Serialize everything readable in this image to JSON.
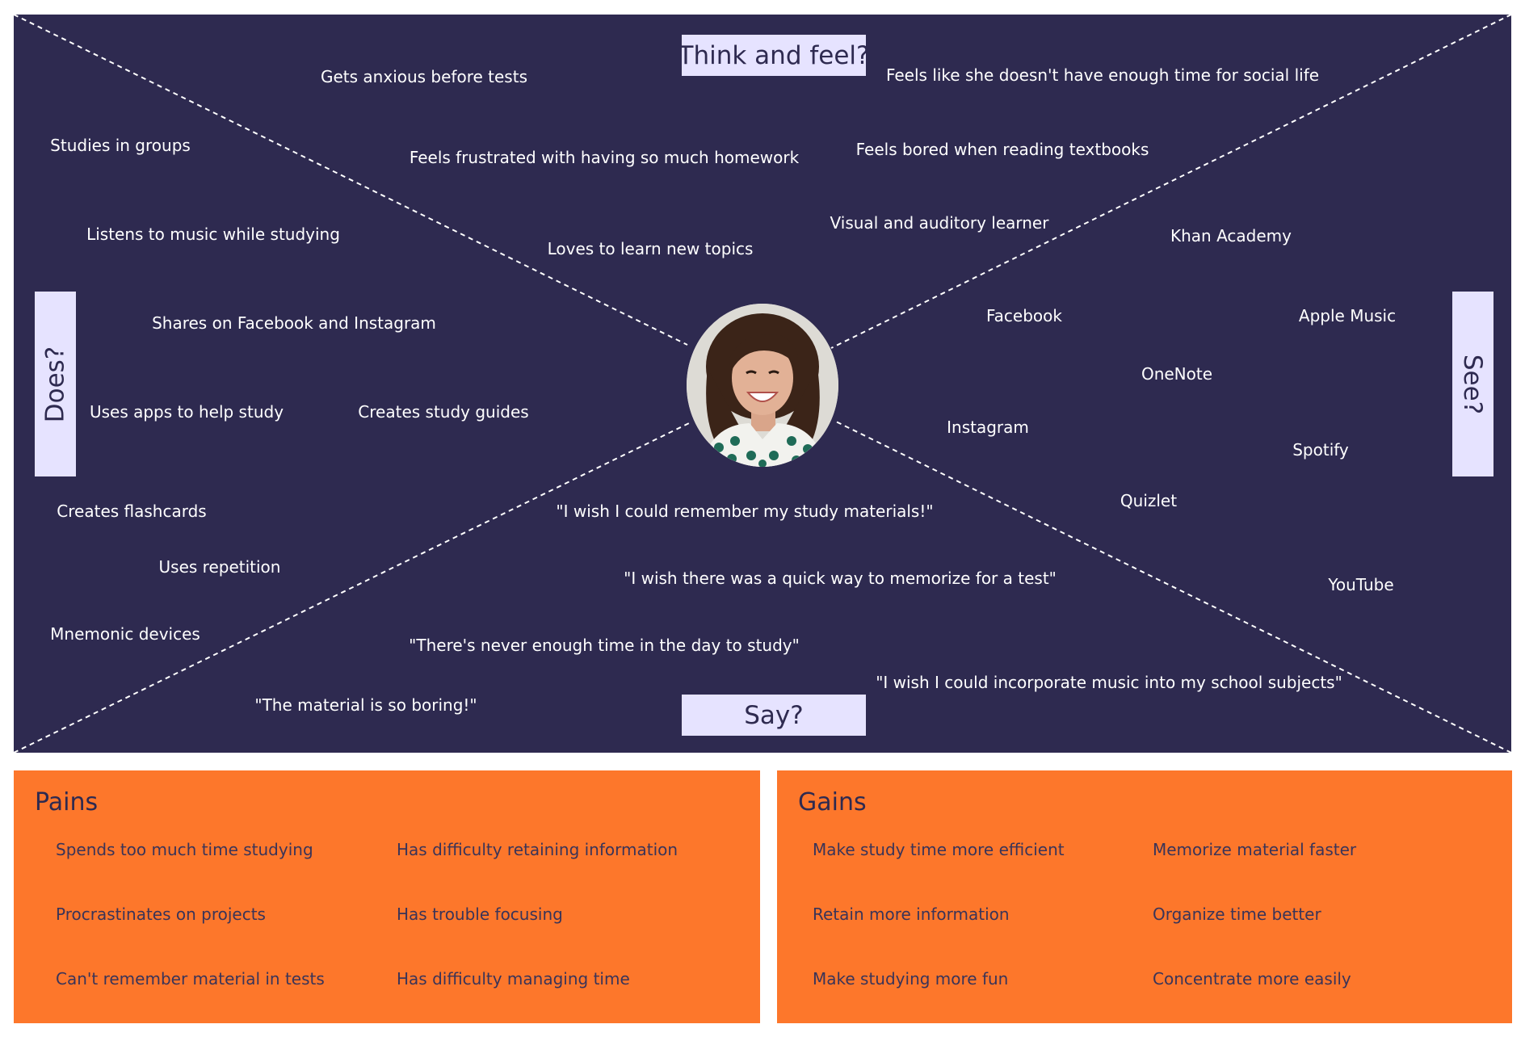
{
  "quadrants": {
    "think_feel": "Think and feel?",
    "does": "Does?",
    "see": "See?",
    "say": "Say?"
  },
  "think_feel_items": [
    "Gets anxious before tests",
    "Feels like she doesn't have enough time for social life",
    "Feels frustrated with having so much homework",
    "Feels bored when reading textbooks",
    "Visual and auditory learner",
    "Loves to learn new topics"
  ],
  "does_items": [
    "Studies in groups",
    "Listens to music while studying",
    "Shares on Facebook and Instagram",
    "Uses apps to help study",
    "Creates study guides",
    "Creates flashcards",
    "Uses repetition",
    "Mnemonic devices"
  ],
  "see_items": [
    "Khan Academy",
    "Facebook",
    "Apple Music",
    "OneNote",
    "Instagram",
    "Spotify",
    "Quizlet",
    "YouTube"
  ],
  "say_items": [
    "\"I wish I could remember my study materials!\"",
    "\"I wish there was a quick way to memorize for a test\"",
    "\"There's never enough time in the day to study\"",
    "\"I wish I could incorporate music into my school subjects\"",
    "\"The material is so boring!\""
  ],
  "pains": {
    "title": "Pains",
    "items": [
      "Spends too much time studying",
      "Has difficulty retaining information",
      "Procrastinates on projects",
      "Has trouble focusing",
      "Can't remember material in tests",
      "Has difficulty managing time"
    ]
  },
  "gains": {
    "title": "Gains",
    "items": [
      "Make study time more efficient",
      "Memorize material faster",
      "Retain more information",
      "Organize time better",
      "Make studying more fun",
      "Concentrate more easily"
    ]
  },
  "colors": {
    "map_background": "#2e2a50",
    "label_background": "#e6e3ff",
    "panel_background": "#fd772b",
    "note_text": "#ffffff"
  }
}
